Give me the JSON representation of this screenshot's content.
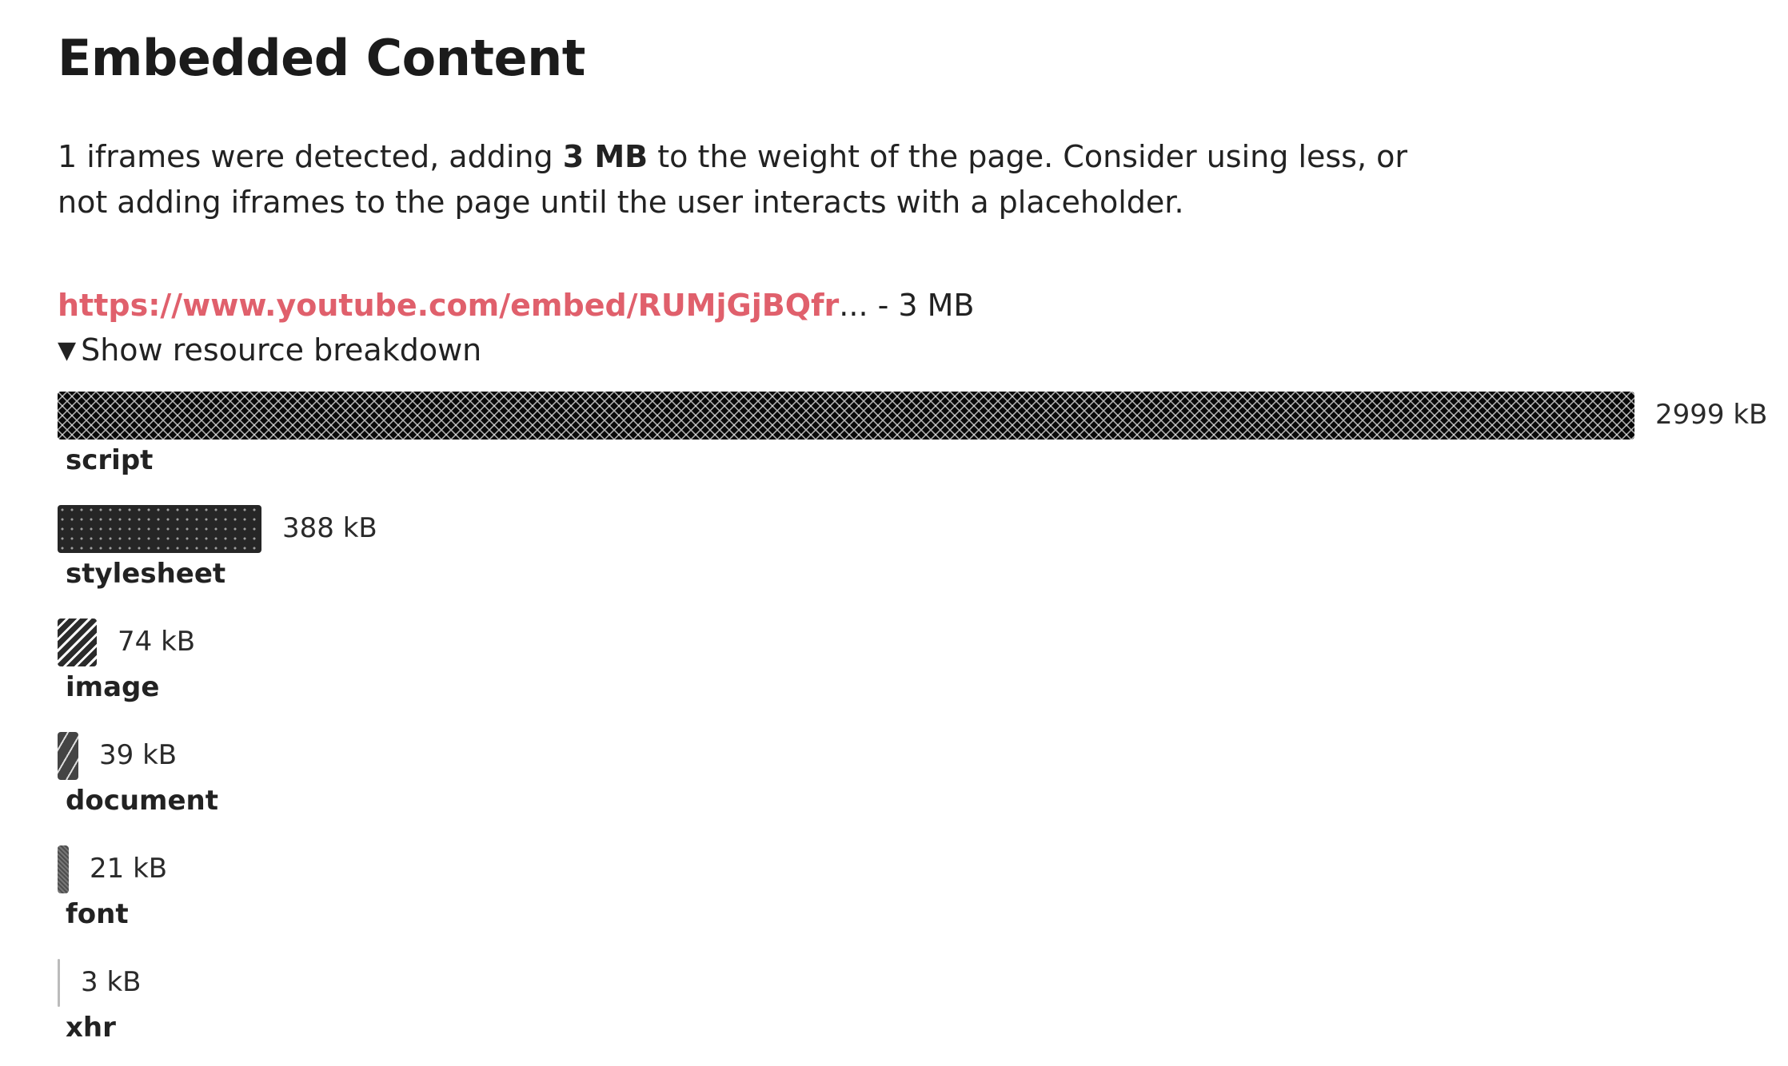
{
  "heading": "Embedded Content",
  "description": {
    "part1": "1 iframes were detected, adding ",
    "bold": "3 MB",
    "part2": " to the weight of the page. Consider using less, or not adding iframes to the page until the user interacts with a placeholder."
  },
  "iframe": {
    "url_text": "https://www.youtube.com/embed/RUMjGjBQfr",
    "suffix": "... - 3 MB"
  },
  "toggle_label": "Show resource breakdown",
  "toggle_icon": "triangle-down-icon",
  "chart_data": {
    "type": "bar",
    "orientation": "horizontal",
    "categories": [
      "script",
      "stylesheet",
      "image",
      "document",
      "font",
      "xhr"
    ],
    "values": [
      2999,
      388,
      74,
      39,
      21,
      3
    ],
    "value_labels": [
      "2999 kB",
      "388 kB",
      "74 kB",
      "39 kB",
      "21 kB",
      "3 kB"
    ],
    "patterns": [
      "crosshatch-dark",
      "dots-dark",
      "diagonal-stripes",
      "sparse-stripes",
      "fine-hatch",
      "light-solid"
    ],
    "xlim": [
      0,
      2999
    ],
    "colors": {
      "accent_link": "#e0606c",
      "bar_dark": "#0a0a0a"
    }
  }
}
